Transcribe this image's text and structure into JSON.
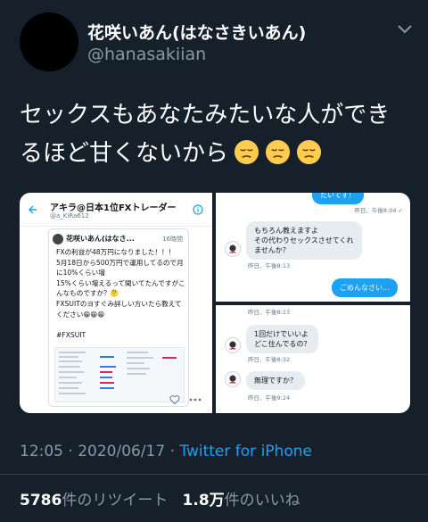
{
  "author": {
    "name": "花咲いあん(はなさきいあん)",
    "handle": "@hanasakiian"
  },
  "tweet": {
    "line1": "セックスもあなたみたいな人ができ",
    "line2": "るほど甘くないから",
    "emojis": [
      "pensive-face",
      "pensive-face",
      "pensive-face"
    ]
  },
  "media": {
    "left": {
      "title": "アキラ@日本1位FXトレーダー",
      "subtitle": "@a_KiRa612",
      "quoted_name": "花咲いあん(はなさ...",
      "quoted_time": "16時間",
      "quoted_text": "FXの利益が48万円になりました！！！\n5月18日から500万円で運用してるので月に10%くらい増\n15%くらい増えるって聞いてたんですがこんなものですか？🤔\nFXSUITのヨすぐみ詳しい方いたら教えてください😁😁😁\n\n#FXSUIT"
    },
    "right_top": {
      "top_text": "たいです！",
      "top_meta": "昨日、午後8:04 ✓",
      "bubble1": "もちろん教えますよ\nその代わりセックスさせてくれ\nませんか？",
      "meta1": "昨日、午後8:13",
      "bubble2": "ごめんなさい...",
      "meta2": "昨日、午後8:23"
    },
    "right_bottom": {
      "meta0": "昨日、午後8:23",
      "bubble1": "1回だけでいいよ\nどこ住んでるの？",
      "meta1": "昨日、午後8:32",
      "bubble2": "無理ですか？",
      "meta2": "昨日、午後9:24"
    }
  },
  "footer": {
    "time": "12:05 · 2020/06/17 · ",
    "source": "Twitter for iPhone",
    "retweets_count": "5786",
    "retweets_label": "件のリツイート",
    "likes_count": "1.8万",
    "likes_label": "件のいいね"
  },
  "colors": {
    "background": "#15202b",
    "accent": "#1da1f2",
    "muted": "#8899a6"
  }
}
